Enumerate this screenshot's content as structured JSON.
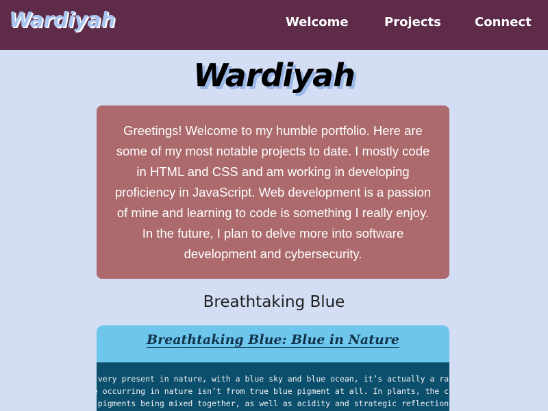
{
  "nav": {
    "brand": "Wardiyah",
    "links": [
      "Welcome",
      "Projects",
      "Connect"
    ]
  },
  "hero": {
    "title": "Wardiyah"
  },
  "intro": {
    "text": "Greetings! Welcome to my humble portfolio. Here are some of my most notable projects to date. I mostly code in HTML and CSS and am working in developing proficiency in JavaScript. Web development is a passion of mine and learning to code is something I really enjoy. In the future, I plan to delve more into software development and cybersecurity."
  },
  "project": {
    "heading": "Breathtaking Blue",
    "preview_title": "Breathtaking Blue: Blue in Nature",
    "preview_lines": [
      "m very present in nature, with a blue sky and blue ocean, it’s actually a rare",
      "ue occurring in nature isn’t from true blue pigment at all. In plants, the colo",
      "c pigments being mixed together, as well as acidity and strategic reflection of"
    ]
  },
  "colors": {
    "navbar": "#5e2b48",
    "page_background": "#d3ddf3",
    "intro_card": "#ac6a6c",
    "brand_text": "#a9c6f0",
    "preview_header": "#6fc6ec",
    "preview_body": "#0b4f6d"
  }
}
